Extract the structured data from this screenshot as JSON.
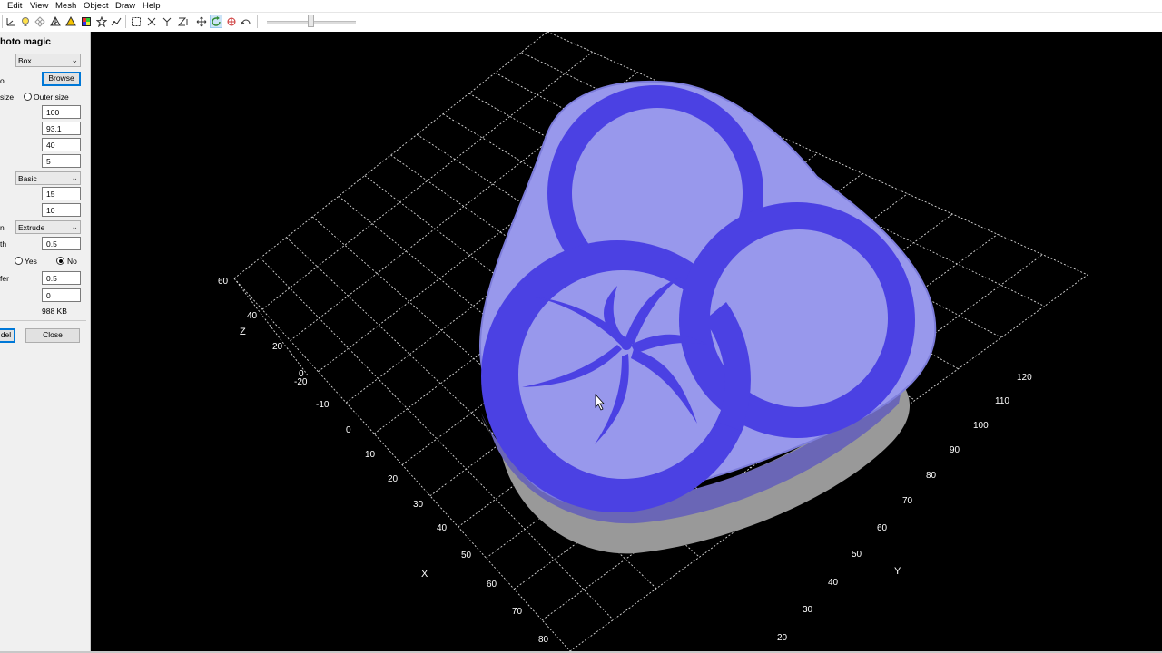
{
  "menu": [
    "Edit",
    "View",
    "Mesh",
    "Object",
    "Draw",
    "Help"
  ],
  "toolbar": {
    "icons": [
      "axes-icon",
      "light-icon",
      "grid-icon",
      "wireframe-icon",
      "shaded-icon",
      "palette-icon",
      "star-icon",
      "graph-icon",
      "select-box-icon",
      "mirror-x-icon",
      "mirror-y-icon",
      "mirror-z-icon",
      "move-icon",
      "rotate-icon",
      "scale-icon",
      "undo-icon"
    ],
    "zoom_slider": {
      "value": 0.5
    }
  },
  "panel": {
    "title": "hoto magic",
    "shape_select": "Box",
    "row_browse_label": "o",
    "browse_button": "Browse",
    "size_label": "size",
    "outer_size_label": "Outer size",
    "values": [
      "100",
      "93.1",
      "40",
      "5"
    ],
    "mode_select": "Basic",
    "values2": [
      "15",
      "10"
    ],
    "extrude_label": "n",
    "extrude_select": "Extrude",
    "depth_label": "th",
    "depth_value": "0.5",
    "yes_label": "Yes",
    "no_label": "No",
    "fer_label": "fer",
    "fer_value": "0.5",
    "zero_value": "0",
    "size_kb": "988 KB",
    "model_button": "del",
    "close_button": "Close"
  },
  "viewport": {
    "colors": {
      "background": "#000000",
      "top_face": "#9898ec",
      "top_rim": "#8d8de6",
      "inlay": "#4b41e3",
      "side_blue": "#6a66b6",
      "side_gray": "#999999",
      "grid": "#d9d9d9"
    },
    "z_axis": {
      "label": "Z",
      "ticks": [
        "60",
        "40",
        "20",
        "0"
      ]
    },
    "x_axis": {
      "label": "X",
      "ticks": [
        "-20",
        "-10",
        "0",
        "10",
        "20",
        "30",
        "40",
        "50",
        "60",
        "70",
        "80"
      ]
    },
    "y_axis": {
      "label": "Y",
      "ticks": [
        "20",
        "30",
        "40",
        "50",
        "60",
        "70",
        "80",
        "90",
        "100",
        "110",
        "120"
      ]
    }
  }
}
